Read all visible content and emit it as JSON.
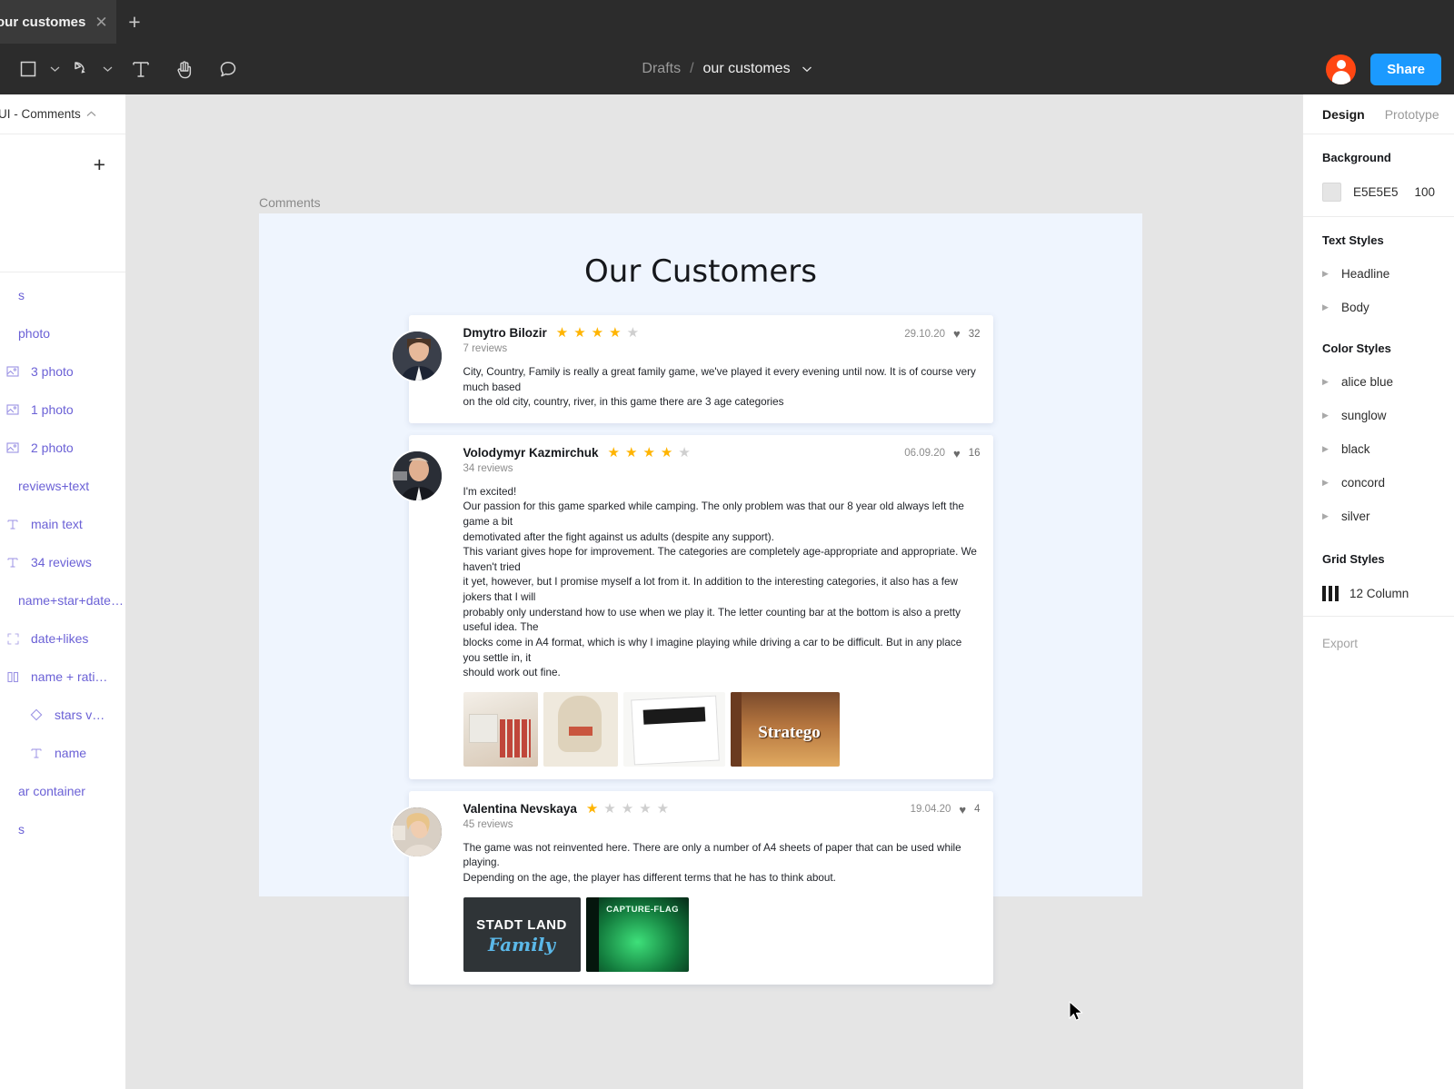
{
  "tab": {
    "title": "our customes",
    "close_icon": "close-icon",
    "new_tab_icon": "plus-icon"
  },
  "toolbar": {
    "tools": [
      {
        "name": "frame-tool",
        "icon": "square-icon",
        "has_caret": true
      },
      {
        "name": "pen-tool",
        "icon": "pen-icon",
        "has_caret": true
      },
      {
        "name": "text-tool",
        "icon": "text-icon",
        "has_caret": false
      },
      {
        "name": "hand-tool",
        "icon": "hand-icon",
        "has_caret": false
      },
      {
        "name": "comment-tool",
        "icon": "comment-bubble-icon",
        "has_caret": false
      }
    ],
    "breadcrumb_root": "Drafts",
    "breadcrumb_sep": "/",
    "breadcrumb_file": "our customes",
    "share_label": "Share",
    "avatar_icon": "user-avatar",
    "accent_share": "#1B9AFF",
    "accent_avatar": "#FF4612"
  },
  "left_panel": {
    "page_name": "UI - Comments",
    "add_icon": "plus-icon",
    "layers": [
      {
        "label": "s",
        "icon": "",
        "depth": 0
      },
      {
        "label": "photo",
        "icon": "",
        "depth": 0
      },
      {
        "label": "3 photo",
        "icon": "image-icon",
        "depth": 1
      },
      {
        "label": "1 photo",
        "icon": "image-icon",
        "depth": 1
      },
      {
        "label": "2 photo",
        "icon": "image-icon",
        "depth": 1
      },
      {
        "label": "reviews+text",
        "icon": "",
        "depth": 0
      },
      {
        "label": "main text",
        "icon": "text-icon",
        "depth": 1
      },
      {
        "label": "34 reviews",
        "icon": "text-icon",
        "depth": 1
      },
      {
        "label": "name+star+date…",
        "icon": "",
        "depth": 0
      },
      {
        "label": "date+likes",
        "icon": "group-icon",
        "depth": 1
      },
      {
        "label": "name + rati…",
        "icon": "columns-icon",
        "depth": 1
      },
      {
        "label": "stars v…",
        "icon": "component-icon",
        "depth": 2
      },
      {
        "label": "name",
        "icon": "text-icon",
        "depth": 2
      },
      {
        "label": "ar container",
        "icon": "",
        "depth": 0
      },
      {
        "label": "s",
        "icon": "",
        "depth": 0
      }
    ]
  },
  "canvas": {
    "frame_label": "Comments",
    "page_title": "Our Customers",
    "frame_bg": "#EFF5FE",
    "reviews": [
      {
        "name": "Dmytro Bilozir",
        "reviews_count": "7 reviews",
        "rating": 4,
        "stars_total": 5,
        "date": "29.10.20",
        "likes": "32",
        "heart_icon": "heart-icon",
        "text": [
          "City, Country, Family is really a great family game, we've played it every evening until now. It is of course very much based",
          "on the old city, country, river, in this game there are 3 age categories"
        ],
        "photos": []
      },
      {
        "name": "Volodymyr Kazmirchuk",
        "reviews_count": "34 reviews",
        "rating": 4,
        "stars_total": 5,
        "date": "06.09.20",
        "likes": "16",
        "heart_icon": "heart-icon",
        "text": [
          "I'm excited!",
          "Our passion for this game sparked while camping. The only problem was that our 8 year old always left the game a bit",
          "demotivated after the fight against us adults (despite any support).",
          "This variant gives hope for improvement. The categories are completely age-appropriate and appropriate. We haven't tried",
          "it yet, however, but I promise myself a lot from it. In addition to the interesting categories, it also has a few jokers that I will",
          "probably only understand how to use when we play it. The letter counting bar at the bottom is also a pretty useful idea. The",
          "blocks come in A4 format, which is why I imagine playing while driving a car to be difficult. But in any place you settle in, it",
          "should work out fine."
        ],
        "photos": [
          {
            "name": "photo-27-cubes-of-fun",
            "cls": "ph1"
          },
          {
            "name": "photo-fritzo-bag",
            "cls": "ph2"
          },
          {
            "name": "photo-stadt-land-stuss",
            "cls": "ph3"
          },
          {
            "name": "photo-stratego-box",
            "cls": "ph4"
          }
        ]
      },
      {
        "name": "Valentina Nevskaya",
        "reviews_count": "45 reviews",
        "rating": 1,
        "stars_total": 5,
        "date": "19.04.20",
        "likes": "4",
        "heart_icon": "heart-icon",
        "text": [
          "The game was not reinvented here. There are only a number of A4 sheets of paper that can be used while playing.",
          "Depending on the age, the player has different terms that he has to think about."
        ],
        "photos": [
          {
            "name": "photo-stadt-land-family",
            "cls": "ph5"
          },
          {
            "name": "photo-capture-flag",
            "cls": "ph6"
          }
        ]
      }
    ],
    "star_on_color": "#FFB400",
    "star_off_color": "#CFCFCF"
  },
  "right_panel": {
    "tabs": [
      {
        "label": "Design",
        "active": true
      },
      {
        "label": "Prototype",
        "active": false
      }
    ],
    "background": {
      "heading": "Background",
      "hex": "E5E5E5",
      "opacity": "100"
    },
    "text_styles": {
      "heading": "Text Styles",
      "items": [
        "Headline",
        "Body"
      ]
    },
    "color_styles": {
      "heading": "Color Styles",
      "items": [
        "alice blue",
        "sunglow",
        "black",
        "concord",
        "silver"
      ]
    },
    "grid_styles": {
      "heading": "Grid Styles",
      "items": [
        {
          "label": "12 Column",
          "icon": "grid-columns-icon"
        }
      ]
    },
    "export_label": "Export"
  }
}
